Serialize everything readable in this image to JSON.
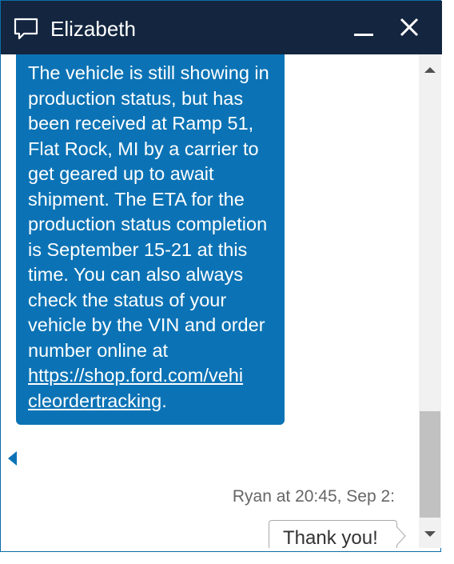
{
  "window": {
    "title": "Elizabeth",
    "icons": {
      "chat": "chat-bubble-icon",
      "minimize": "minimize-icon",
      "close": "close-icon"
    }
  },
  "messages": [
    {
      "sender": "agent",
      "text": "The vehicle is still showing in production status, but has been received at Ramp 51, Flat Rock, MI by a carrier to get geared up to await shipment. The ETA for the production status completion is September 15-21 at this time. You can also always check the status of your vehicle by the VIN and order number online at",
      "link": "https://shop.ford.com/vehicleordertracking",
      "link_line1": "https://shop.ford.com/vehi",
      "link_line2": "cleordertracking",
      "suffix": "."
    },
    {
      "sender": "user",
      "meta": "Ryan at 20:45, Sep 2:",
      "text": "Thank you!"
    }
  ],
  "colors": {
    "titlebar": "#13253f",
    "agent_bubble": "#0b73b5",
    "border": "#0b6ea8"
  }
}
